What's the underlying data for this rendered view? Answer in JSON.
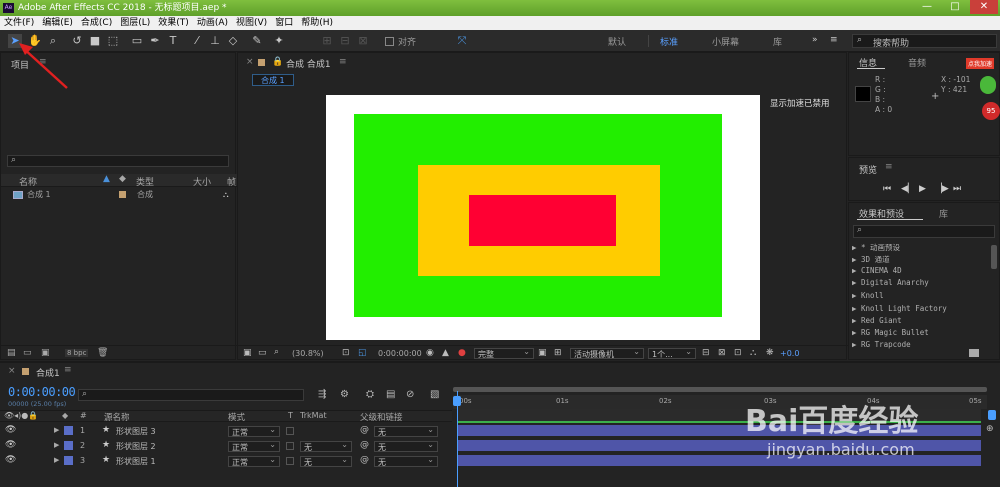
{
  "app": {
    "title": "Adobe After Effects CC 2018 - 无标题项目.aep *",
    "logo": "Ae"
  },
  "window_controls": {
    "minimize": "—",
    "maximize": "□",
    "close": "✕"
  },
  "menu": [
    "文件(F)",
    "编辑(E)",
    "合成(C)",
    "图层(L)",
    "效果(T)",
    "动画(A)",
    "视图(V)",
    "窗口",
    "帮助(H)"
  ],
  "toolbar": {
    "align_label": "对齐",
    "workspaces": [
      "默认",
      "标准",
      "小屏幕",
      "库"
    ],
    "active_workspace": "标准",
    "search_placeholder": "搜索帮助"
  },
  "project_panel": {
    "title": "项目",
    "columns": [
      "名称",
      "类型",
      "大小",
      "帧"
    ],
    "items": [
      {
        "name": "合成 1",
        "type": "合成"
      }
    ],
    "bpc": "8 bpc"
  },
  "comp_panel": {
    "tab_label": "合成 合成1",
    "subtab": "合成 1",
    "zoom": "(30.8%)",
    "timecode": "0:00:00:00",
    "resolution": "完整",
    "camera": "活动摄像机",
    "views": "1个...",
    "offset": "+0.0",
    "gpu_notice": "显示加速已禁用",
    "colors": {
      "bg": "#ffffff",
      "outer": "#22ee00",
      "middle": "#ffcc00",
      "inner": "#ff0033"
    }
  },
  "info_panel": {
    "tabs": [
      "信息",
      "音频"
    ],
    "r": "R :",
    "g": "G :",
    "b": "B :",
    "a": "A : 0",
    "x": "X : -101",
    "y": "Y : 421"
  },
  "preview_panel": {
    "title": "预览"
  },
  "effects_panel": {
    "tabs": [
      "效果和预设",
      "库"
    ],
    "items": [
      "▶ * 动画预设",
      "▶ 3D 通道",
      "▶ CINEMA 4D",
      "▶ Digital Anarchy",
      "▶ Knoll",
      "▶ Knoll Light Factory",
      "▶ Red Giant",
      "▶ RG Magic Bullet",
      "▶ RG Trapcode"
    ]
  },
  "timeline": {
    "tab": "合成1",
    "timecode": "0:00:00:00",
    "fps": "00000 (25.00 fps)",
    "columns": {
      "num": "#",
      "name": "源名称",
      "mode": "模式",
      "t": "T",
      "trkmat": "TrkMat",
      "parent": "父级和链接"
    },
    "ruler": [
      "00s",
      "01s",
      "02s",
      "03s",
      "04s",
      "05s"
    ],
    "layers": [
      {
        "num": "1",
        "name": "形状图层 3",
        "mode": "正常",
        "trkmat": "",
        "parent": "无"
      },
      {
        "num": "2",
        "name": "形状图层 2",
        "mode": "正常",
        "trkmat": "无",
        "parent": "无"
      },
      {
        "num": "3",
        "name": "形状图层 1",
        "mode": "正常",
        "trkmat": "无",
        "parent": "无"
      }
    ]
  },
  "watermark": {
    "brand": "Bai百度经验",
    "url": "jingyan.baidu.com"
  },
  "ad_badge": {
    "text": "点我加速",
    "number": "95"
  }
}
